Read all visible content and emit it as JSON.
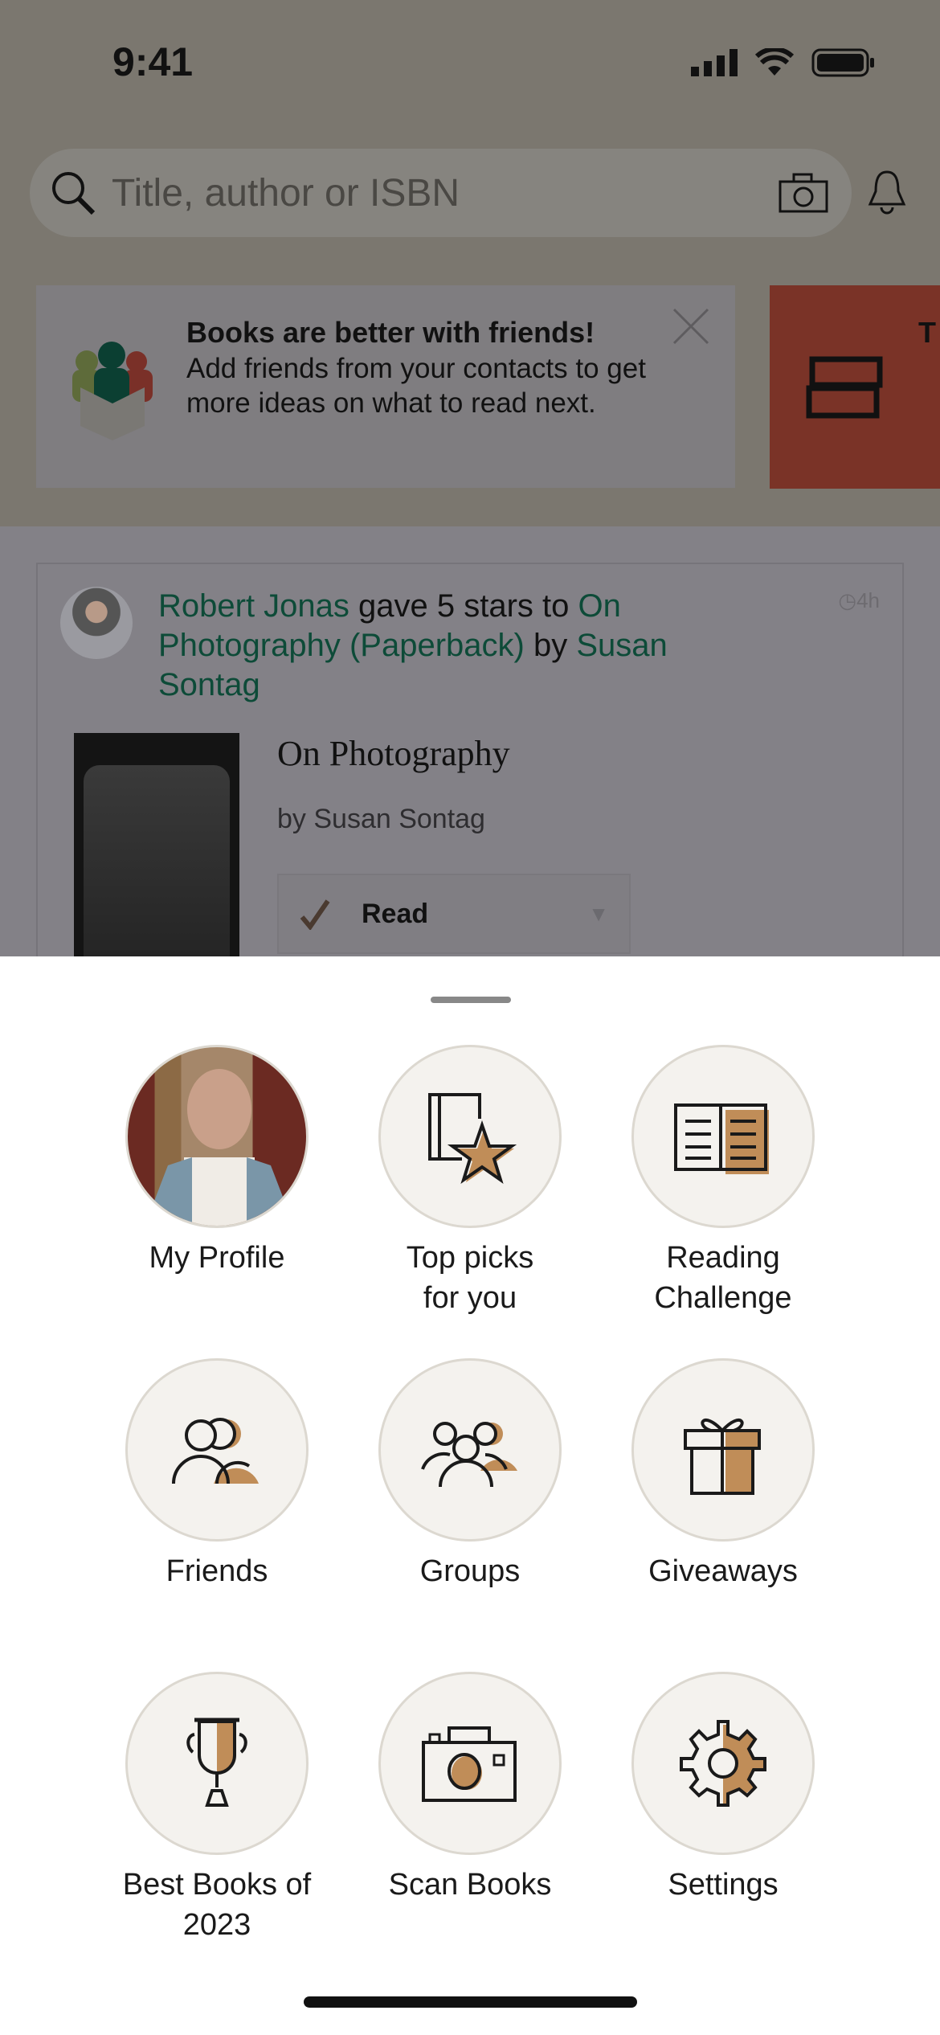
{
  "status_bar": {
    "time": "9:41"
  },
  "search": {
    "placeholder": "Title, author or ISBN"
  },
  "banner": {
    "title": "Books are better with friends!",
    "description": "Add friends from your contacts to get more ideas on what to read next."
  },
  "banner2": {
    "title_partial": "T"
  },
  "feed": {
    "user": "Robert Jonas",
    "action": " gave 5 stars to ",
    "book_link": "On Photography (Paperback)",
    "by": " by ",
    "author": "Susan Sontag",
    "time_ago": "4h",
    "book_title": "On Photography",
    "book_author": "by Susan Sontag",
    "shelf": "Read"
  },
  "menu": {
    "items": [
      {
        "label": "My Profile",
        "icon": "profile-photo"
      },
      {
        "label": "Top picks for you",
        "icon": "book-star-icon"
      },
      {
        "label": "Reading Challenge",
        "icon": "open-book-icon"
      },
      {
        "label": "Friends",
        "icon": "friends-icon"
      },
      {
        "label": "Groups",
        "icon": "groups-icon"
      },
      {
        "label": "Giveaways",
        "icon": "gift-icon"
      },
      {
        "label": "Best Books of 2023",
        "icon": "trophy-icon"
      },
      {
        "label": "Scan Books",
        "icon": "camera-icon"
      },
      {
        "label": "Settings",
        "icon": "gear-icon"
      }
    ]
  },
  "colors": {
    "accent": "#c08d58",
    "link_green": "#0d4b38",
    "circle_bg": "#f4f2ee"
  }
}
